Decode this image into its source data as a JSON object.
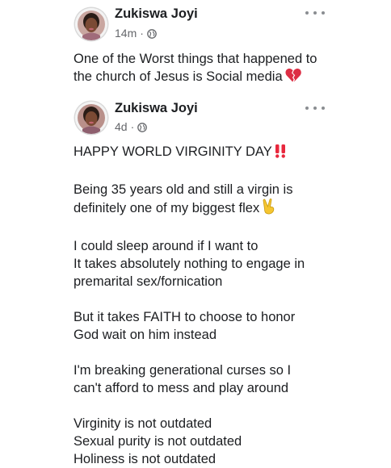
{
  "posts": [
    {
      "author": "Zukiswa Joyi",
      "time": "14m",
      "separator": "·",
      "privacy_icon": "globe-icon",
      "text_lines": [
        "One of the Worst things that happened to",
        "the church of Jesus is Social media"
      ],
      "trailing_emoji": "broken-heart-icon"
    },
    {
      "author": "Zukiswa Joyi",
      "time": "4d",
      "separator": "·",
      "privacy_icon": "globe-icon",
      "paragraphs": [
        [
          "HAPPY WORLD VIRGINITY DAY"
        ],
        [
          "Being 35 years old and still a virgin is",
          "definitely one of my biggest flex"
        ],
        [
          "I could sleep around if I want to",
          "It takes absolutely nothing to engage in",
          "premarital sex/fornication"
        ],
        [
          "But it takes FAITH to choose to honor",
          "God wait on him instead"
        ],
        [
          "I'm breaking generational curses so I",
          "can't afford to mess and play around"
        ],
        [
          "Virginity is not outdated",
          "Sexual purity is not outdated",
          "Holiness is not outdated"
        ]
      ],
      "emojis": [
        "double-exclamation-icon",
        "victory-hand-icon"
      ]
    }
  ],
  "colors": {
    "text": "#1c1e21",
    "secondary": "#65676b",
    "emoji_red": "#e8283d",
    "emoji_yellow": "#f5c530"
  }
}
